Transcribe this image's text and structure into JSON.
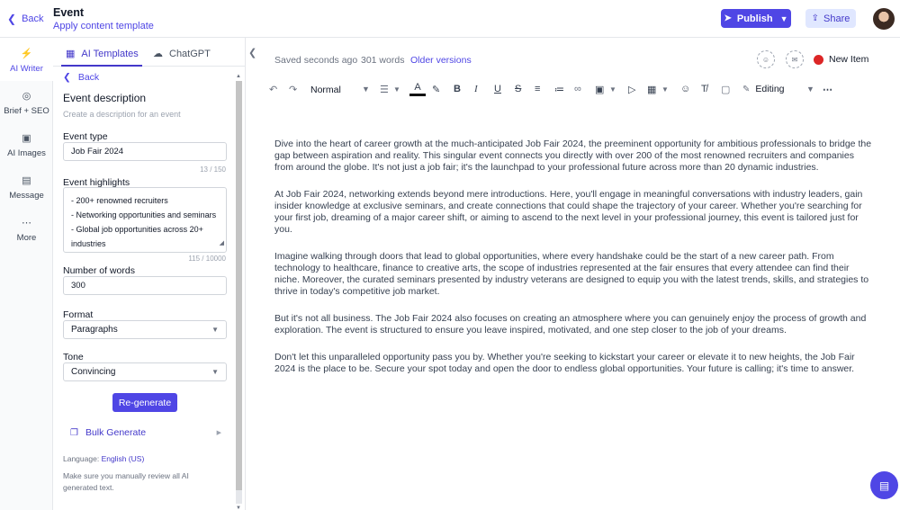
{
  "header": {
    "back_label": "Back",
    "title": "Event",
    "subtitle": "Apply content template",
    "publish_label": "Publish",
    "share_label": "Share"
  },
  "rail": {
    "items": [
      {
        "label": "AI Writer",
        "icon": "bolt-icon"
      },
      {
        "label": "Brief + SEO",
        "icon": "target-icon"
      },
      {
        "label": "AI Images",
        "icon": "image-icon"
      },
      {
        "label": "Message",
        "icon": "chat-icon"
      },
      {
        "label": "More",
        "icon": "more-icon"
      }
    ]
  },
  "panel": {
    "tabs": [
      {
        "label": "AI Templates",
        "icon": "grid-icon"
      },
      {
        "label": "ChatGPT",
        "icon": "chat-bubbles-icon"
      }
    ],
    "back_label": "Back",
    "section_title": "Event description",
    "section_subtitle": "Create a description for an event",
    "event_type": {
      "label": "Event type",
      "value": "Job Fair 2024",
      "counter": "13 / 150"
    },
    "event_highlights": {
      "label": "Event highlights",
      "lines": [
        "- 200+ renowned recruiters",
        "- Networking opportunities and seminars",
        "- Global job opportunities across 20+",
        "industries"
      ],
      "counter": "115 / 10000"
    },
    "word_count": {
      "label": "Number of words",
      "value": "300"
    },
    "format": {
      "label": "Format",
      "value": "Paragraphs"
    },
    "tone": {
      "label": "Tone",
      "value": "Convincing"
    },
    "regenerate_label": "Re-generate",
    "bulk_label": "Bulk Generate",
    "language_prefix": "Language:",
    "language_value": "English (US)",
    "note": "Make sure you manually review all AI generated text."
  },
  "editor": {
    "saved": "Saved seconds ago",
    "words": "301 words",
    "older_versions": "Older versions",
    "status_label": "New Item",
    "status_color": "#dc2626",
    "toolbar": {
      "style_value": "Normal",
      "mode_value": "Editing"
    },
    "paragraphs": [
      "Dive into the heart of career growth at the much-anticipated Job Fair 2024, the preeminent opportunity for ambitious professionals to bridge the gap between aspiration and reality. This singular event connects you directly with over 200 of the most renowned recruiters and companies from around the globe. It's not just a job fair; it's the launchpad to your professional future across more than 20 dynamic industries.",
      "At Job Fair 2024, networking extends beyond mere introductions. Here, you'll engage in meaningful conversations with industry leaders, gain insider knowledge at exclusive seminars, and create connections that could shape the trajectory of your career. Whether you're searching for your first job, dreaming of a major career shift, or aiming to ascend to the next level in your professional journey, this event is tailored just for you.",
      "Imagine walking through doors that lead to global opportunities, where every handshake could be the start of a new career path. From technology to healthcare, finance to creative arts, the scope of industries represented at the fair ensures that every attendee can find their niche. Moreover, the curated seminars presented by industry veterans are designed to equip you with the latest trends, skills, and strategies to thrive in today's competitive job market.",
      "But it's not all business. The Job Fair 2024 also focuses on creating an atmosphere where you can genuinely enjoy the process of growth and exploration. The event is structured to ensure you leave inspired, motivated, and one step closer to the job of your dreams.",
      "Don't let this unparalleled opportunity pass you by. Whether you're seeking to kickstart your career or elevate it to new heights, the Job Fair 2024 is the place to be. Secure your spot today and open the door to endless global opportunities. Your future is calling; it's time to answer."
    ]
  },
  "colors": {
    "accent": "#4f46e5",
    "accent_light": "#e0e7ff"
  }
}
